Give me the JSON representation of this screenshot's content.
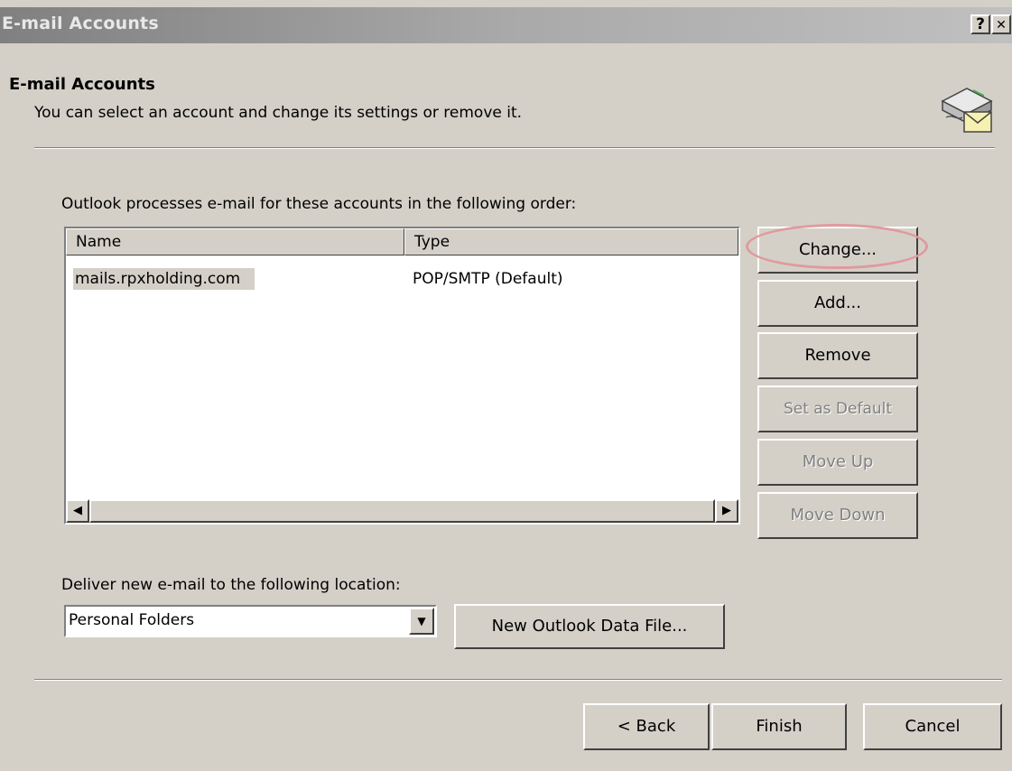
{
  "window": {
    "title": "E-mail Accounts",
    "help_glyph": "?",
    "close_glyph": "✕"
  },
  "header": {
    "title": "E-mail Accounts",
    "description": "You can select an account and change its settings or remove it.",
    "icon": "email-accounts-icon"
  },
  "accounts": {
    "label": "Outlook processes e-mail for these accounts in the following order:",
    "columns": [
      "Name",
      "Type"
    ],
    "rows": [
      {
        "name": "mails.rpxholding.com",
        "type": "POP/SMTP (Default)"
      }
    ],
    "buttons": {
      "change": "Change...",
      "add": "Add...",
      "remove": "Remove",
      "set_default": "Set as Default",
      "move_up": "Move Up",
      "move_down": "Move Down"
    }
  },
  "delivery": {
    "label": "Deliver new e-mail to the following location:",
    "location": "Personal Folders",
    "new_file_button": "New Outlook Data File..."
  },
  "footer": {
    "back": "< Back",
    "finish": "Finish",
    "cancel": "Cancel"
  },
  "colors": {
    "face": "#d4d0c8",
    "highlight_ring": "#e09a9e",
    "disabled_text": "#808080"
  }
}
